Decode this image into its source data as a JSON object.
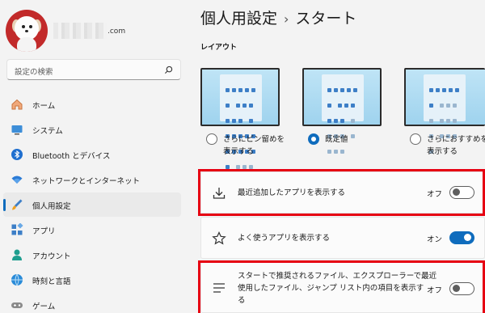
{
  "user": {
    "email_domain": ".com"
  },
  "search": {
    "placeholder": "設定の検索"
  },
  "sidebar": {
    "items": [
      {
        "label": "ホーム",
        "icon": "home-icon"
      },
      {
        "label": "システム",
        "icon": "system-icon"
      },
      {
        "label": "Bluetooth とデバイス",
        "icon": "bluetooth-icon"
      },
      {
        "label": "ネットワークとインターネット",
        "icon": "wifi-icon"
      },
      {
        "label": "個人用設定",
        "icon": "brush-icon",
        "active": true
      },
      {
        "label": "アプリ",
        "icon": "apps-icon"
      },
      {
        "label": "アカウント",
        "icon": "account-icon"
      },
      {
        "label": "時刻と言語",
        "icon": "time-language-icon"
      },
      {
        "label": "ゲーム",
        "icon": "game-icon"
      }
    ]
  },
  "header": {
    "breadcrumb_parent": "個人用設定",
    "breadcrumb_sep": "›",
    "breadcrumb_current": "スタート"
  },
  "layout_section": {
    "title": "レイアウト",
    "options": [
      {
        "line1": "さらにピン留めを",
        "line2": "表示する",
        "selected": false
      },
      {
        "line1": "既定値",
        "line2": "",
        "selected": true
      },
      {
        "line1": "さらにおすすめを",
        "line2": "表示する",
        "selected": false
      }
    ]
  },
  "settings": [
    {
      "icon": "download-icon",
      "label": "最近追加したアプリを表示する",
      "state": "オフ",
      "on": false,
      "highlighted": true
    },
    {
      "icon": "star-icon",
      "label": "よく使うアプリを表示する",
      "state": "オン",
      "on": true,
      "highlighted": false
    },
    {
      "icon": "list-icon",
      "label_lines": [
        "スタートで推奨されるファイル、エクスプローラーで最近",
        "使用したファイル、ジャンプ リスト内の項目を表示す",
        "る"
      ],
      "state": "オフ",
      "on": false,
      "highlighted": true
    }
  ],
  "colors": {
    "accent": "#0f6cbd",
    "highlight_border": "#e60012",
    "avatar_bg": "#c22a2a"
  }
}
